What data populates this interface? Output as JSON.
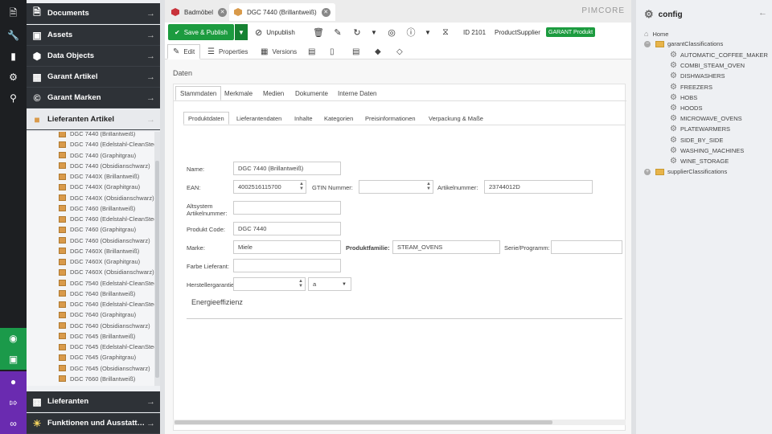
{
  "left_nav": {
    "accordion": [
      {
        "label": "Documents",
        "icon": "document-icon"
      },
      {
        "label": "Assets",
        "icon": "image-icon"
      },
      {
        "label": "Data Objects",
        "icon": "cube-icon"
      },
      {
        "label": "Garant Artikel",
        "icon": "table-icon"
      },
      {
        "label": "Garant Marken",
        "icon": "copyright-icon"
      },
      {
        "label": "Lieferanten Artikel",
        "icon": "box-icon"
      }
    ],
    "bottom_accordion": [
      {
        "label": "Lieferanten",
        "icon": "factory-icon"
      },
      {
        "label": "Funktionen und Ausstatt…",
        "icon": "lightbulb-icon"
      }
    ],
    "tree_items": [
      "DGC 7440 (Brillantweiß)",
      "DGC 7440 (Edelstahl-CleanSteel)",
      "DGC 7440 (Graphitgrau)",
      "DGC 7440 (Obsidianschwarz)",
      "DGC 7440X (Brillantweiß)",
      "DGC 7440X (Graphitgrau)",
      "DGC 7440X (Obsidianschwarz)",
      "DGC 7460 (Brillantweiß)",
      "DGC 7460 (Edelstahl-CleanSteel)",
      "DGC 7460 (Graphitgrau)",
      "DGC 7460 (Obsidianschwarz)",
      "DGC 7460X (Brillantweiß)",
      "DGC 7460X (Graphitgrau)",
      "DGC 7460X (Obsidianschwarz)",
      "DGC 7540 (Edelstahl-CleanSteel)",
      "DGC 7640 (Brillantweiß)",
      "DGC 7640 (Edelstahl-CleanSteel)",
      "DGC 7640 (Graphitgrau)",
      "DGC 7640 (Obsidianschwarz)",
      "DGC 7645 (Brillantweiß)",
      "DGC 7645 (Edelstahl-CleanSteel)",
      "DGC 7645 (Graphitgrau)",
      "DGC 7645 (Obsidianschwarz)",
      "DGC 7660 (Brillantweiß)"
    ]
  },
  "tabs": [
    {
      "label": "Badmöbel"
    },
    {
      "label": "DGC 7440 (Brillantweiß)"
    }
  ],
  "brand": "PIMCORE",
  "toolbar": {
    "save_publish": "Save & Publish",
    "unpublish": "Unpublish",
    "id": "ID 2101",
    "class": "ProductSupplier",
    "badge": "GARANT Produkt"
  },
  "subtabs": {
    "edit": "Edit",
    "properties": "Properties",
    "versions": "Versions"
  },
  "content": {
    "section": "Daten",
    "main_tabs": [
      "Stammdaten",
      "Merkmale",
      "Medien",
      "Dokumente",
      "Interne Daten"
    ],
    "inner_tabs": [
      "Produktdaten",
      "Lieferantendaten",
      "Inhalte",
      "Kategorien",
      "Preisinformationen",
      "Verpackung & Maße"
    ],
    "form": {
      "name_label": "Name:",
      "name_value": "DGC 7440 (Brillantweiß)",
      "ean_label": "EAN:",
      "ean_value": "4002516115700",
      "gtin_label": "GTIN Nummer:",
      "gtin_value": "",
      "artikelnummer_label": "Artikelnummer:",
      "artikelnummer_value": "23744012D",
      "altsystem_label_1": "Altsystem",
      "altsystem_label_2": "Artikelnummer:",
      "altsystem_value": "",
      "produktcode_label": "Produkt Code:",
      "produktcode_value": "DGC 7440",
      "marke_label": "Marke:",
      "marke_value": "Miele",
      "produktfamilie_label": "Produktfamilie:",
      "produktfamilie_value": "STEAM_OVENS",
      "serie_label": "Serie/Programm:",
      "serie_value": "",
      "farbe_label": "Farbe Lieferant:",
      "farbe_value": "",
      "garantie_label": "Herstellergarantie:",
      "garantie_value": "",
      "garantie_unit": "a",
      "energie_title": "Energieeffizienz"
    }
  },
  "right_panel": {
    "title": "config",
    "home": "Home",
    "folder1": "garantClassifications",
    "items": [
      "AUTOMATIC_COFFEE_MAKER",
      "COMBI_STEAM_OVEN",
      "DISHWASHERS",
      "FREEZERS",
      "HOBS",
      "HOODS",
      "MICROWAVE_OVENS",
      "PLATEWARMERS",
      "SIDE_BY_SIDE",
      "WASHING_MACHINES",
      "WINE_STORAGE"
    ],
    "folder2": "supplierClassifications"
  },
  "colors": {
    "accent_green": "#1c9b3f",
    "dark_nav": "#1d1f22",
    "purple": "#6a2bb0"
  }
}
